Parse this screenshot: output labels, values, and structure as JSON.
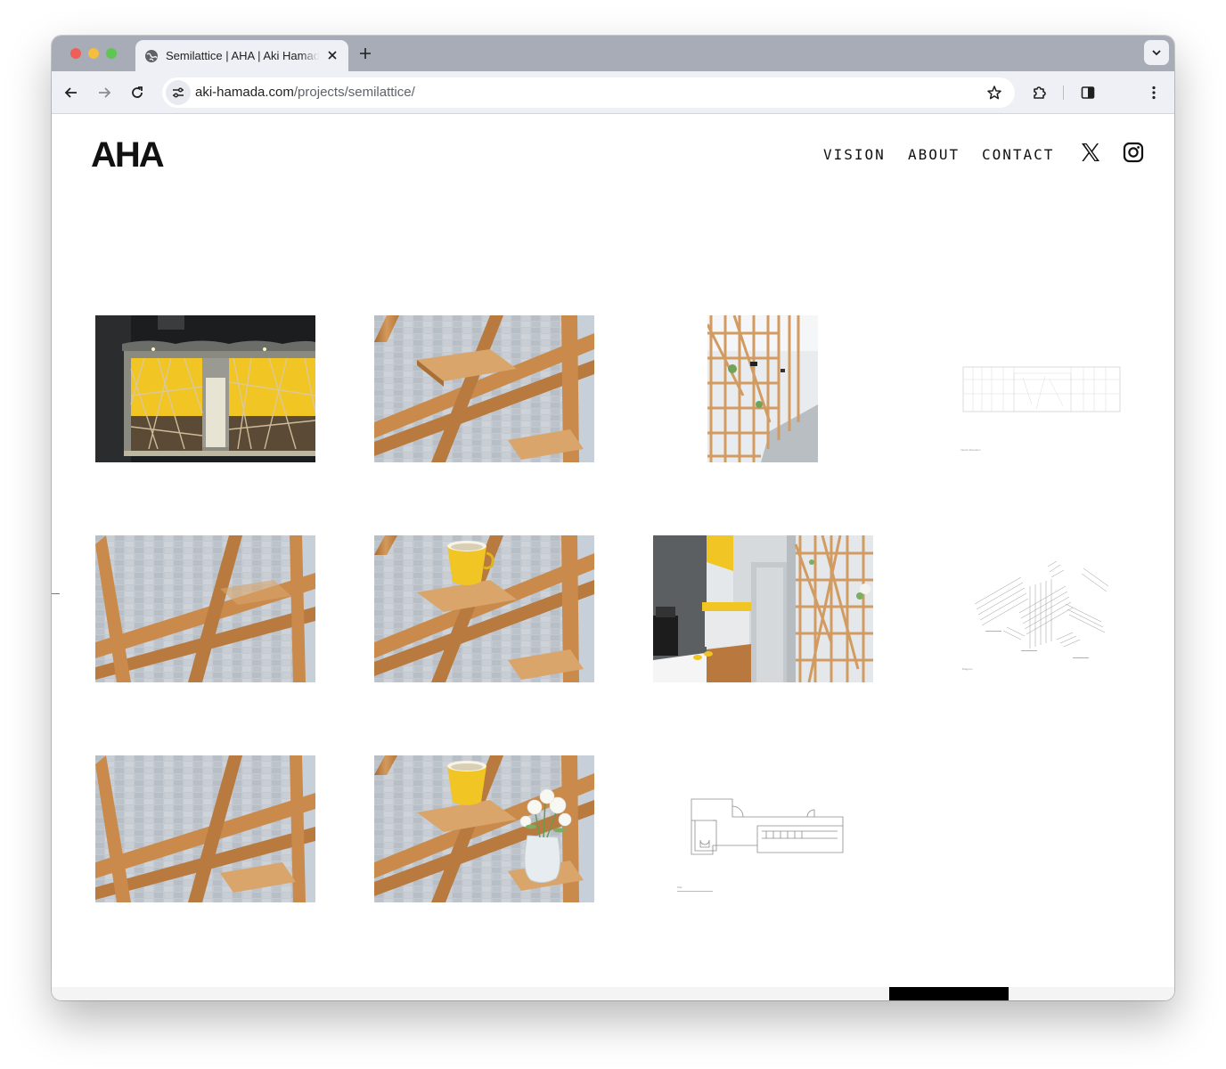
{
  "browser": {
    "tab_title": "Semilattice | AHA | Aki Hamada Architects",
    "url_domain": "aki-hamada.com",
    "url_path": "/projects/semilattice/"
  },
  "site": {
    "logo": "AHA",
    "nav": [
      {
        "label": "VISION"
      },
      {
        "label": "ABOUT"
      },
      {
        "label": "CONTACT"
      }
    ],
    "social": [
      "x-icon",
      "instagram-icon"
    ]
  },
  "gallery": {
    "drawing_labels": {
      "elevation": "Interior Elevation",
      "diagram": "Diagram",
      "plan": "Plan"
    }
  },
  "colors": {
    "wood": "#c9884a",
    "accent_yellow": "#f2c81f",
    "paving": "#bfc6cd",
    "tab_strip": "#a8acb6",
    "toolbar": "#eef0f5"
  }
}
